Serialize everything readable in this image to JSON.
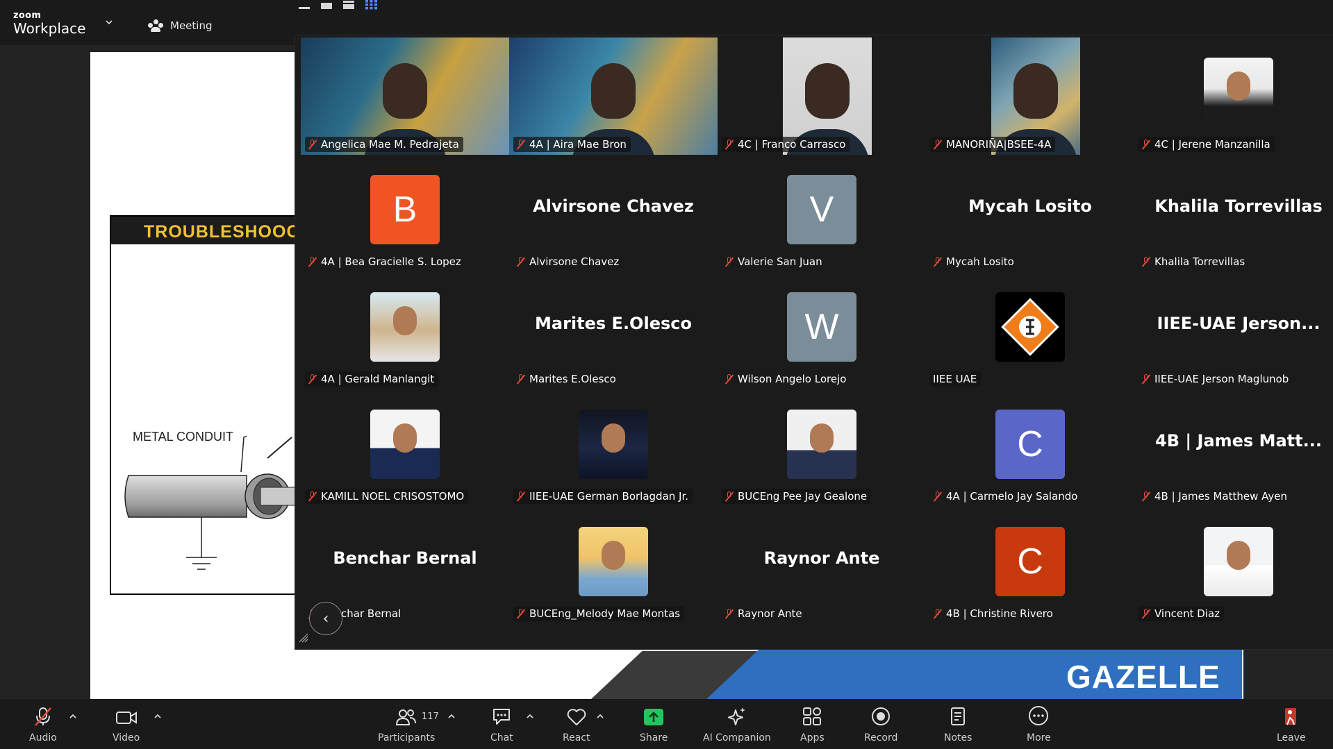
{
  "app": {
    "brand_top": "zoom",
    "brand_bottom": "Workplace",
    "meeting_label": "Meeting"
  },
  "shared": {
    "section_title": "TROUBLESHOOC",
    "diagram_label": "METAL CONDUIT",
    "banner_brand": "GAZELLE"
  },
  "gallery": {
    "tiles": [
      {
        "label": "Angelica Mae M. Pedrajeta",
        "kind": "video",
        "muted": true
      },
      {
        "label": "4A | Aira Mae Bron",
        "kind": "video",
        "muted": true
      },
      {
        "label": "4C | Franco Carrasco",
        "kind": "video",
        "muted": true
      },
      {
        "label": "MANORIÑA|BSEE-4A",
        "kind": "video",
        "muted": true
      },
      {
        "label": "4C | Jerene Manzanilla",
        "kind": "photo",
        "muted": true
      },
      {
        "label": "4A | Bea Gracielle S. Lopez",
        "kind": "initial",
        "initial": "B",
        "color": "#f05423",
        "muted": true
      },
      {
        "label": "Alvirsone Chavez",
        "kind": "name",
        "big": "Alvirsone Chavez",
        "muted": true
      },
      {
        "label": "Valerie San Juan",
        "kind": "initial",
        "initial": "V",
        "color": "#7a8d98",
        "muted": true
      },
      {
        "label": "Mycah Losito",
        "kind": "name",
        "big": "Mycah Losito",
        "muted": true
      },
      {
        "label": "Khalila Torrevillas",
        "kind": "name",
        "big": "Khalila Torrevillas",
        "muted": true
      },
      {
        "label": "4A | Gerald Manlangit",
        "kind": "photo",
        "muted": true
      },
      {
        "label": "Marites E.Olesco",
        "kind": "name",
        "big": "Marites E.Olesco",
        "muted": true
      },
      {
        "label": "Wilson Angelo Lorejo",
        "kind": "initial",
        "initial": "W",
        "color": "#7a8d98",
        "muted": true
      },
      {
        "label": "IIEE UAE",
        "kind": "logo",
        "muted": false
      },
      {
        "label": "IIEE-UAE Jerson Maglunob",
        "kind": "name",
        "big": "IIEE-UAE  Jerson...",
        "muted": true
      },
      {
        "label": "KAMILL NOEL CRISOSTOMO",
        "kind": "photo",
        "muted": true
      },
      {
        "label": "IIEE-UAE German Borlagdan Jr.",
        "kind": "photo",
        "muted": true
      },
      {
        "label": "BUCEng Pee Jay Gealone",
        "kind": "photo",
        "muted": true
      },
      {
        "label": "4A | Carmelo Jay Salando",
        "kind": "initial",
        "initial": "C",
        "color": "#5b66c9",
        "muted": true
      },
      {
        "label": "4B | James Matthew Ayen",
        "kind": "name",
        "big": "4B | James Matt...",
        "muted": true
      },
      {
        "label": "Benchar Bernal",
        "kind": "name",
        "big": "Benchar Bernal",
        "muted": true
      },
      {
        "label": "BUCEng_Melody Mae Montas",
        "kind": "photo",
        "muted": true
      },
      {
        "label": "Raynor Ante",
        "kind": "name",
        "big": "Raynor Ante",
        "muted": true
      },
      {
        "label": "4B | Christine Rivero",
        "kind": "initial",
        "initial": "C",
        "color": "#c9390e",
        "muted": true
      },
      {
        "label": "Vincent Diaz",
        "kind": "photo",
        "muted": true
      }
    ]
  },
  "toolbar": {
    "audio": "Audio",
    "video": "Video",
    "participants": "Participants",
    "participant_count": "117",
    "chat": "Chat",
    "react": "React",
    "share": "Share",
    "ai": "AI Companion",
    "apps": "Apps",
    "record": "Record",
    "notes": "Notes",
    "more": "More",
    "leave": "Leave"
  },
  "colors": {
    "accent_share": "#23c55e",
    "mute_red": "#e0493b",
    "toolbar_bg": "#1a1a1a",
    "gallery_bg": "#1b1b1b"
  }
}
